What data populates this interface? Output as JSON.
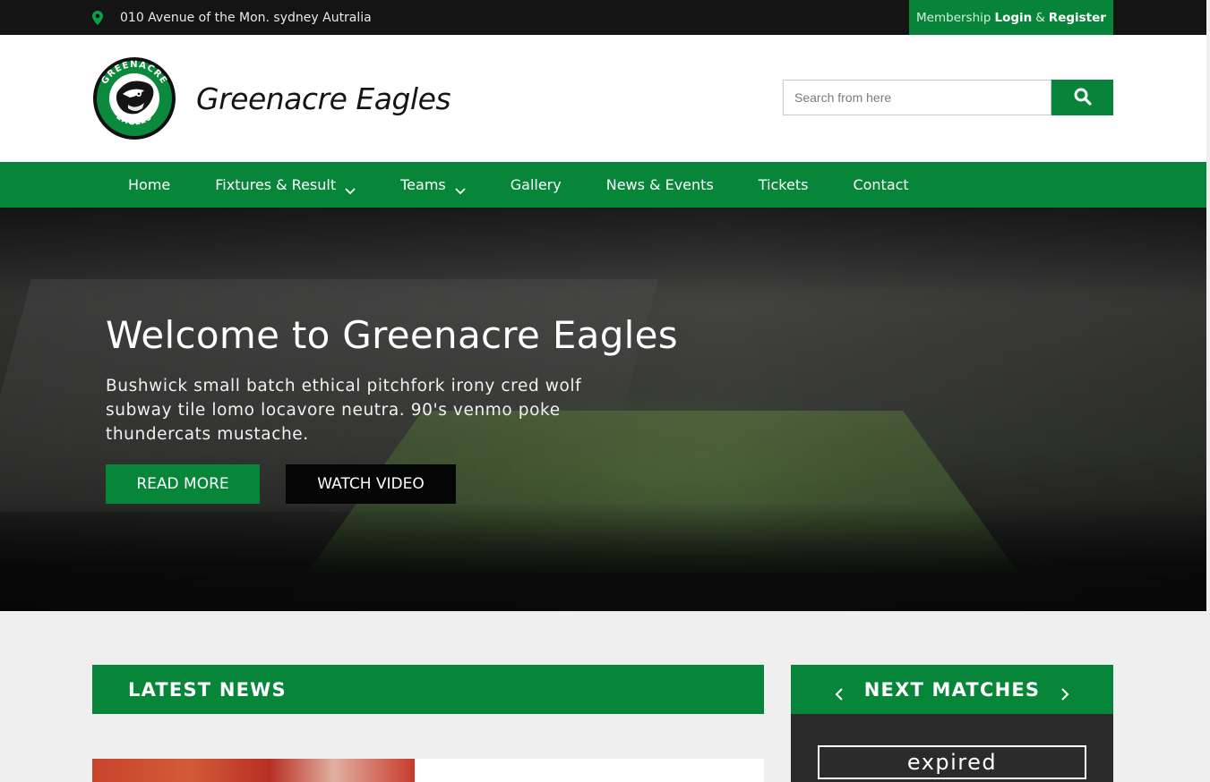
{
  "topbar": {
    "address": "010 Avenue of the Mon. sydney Autralia",
    "membership_label": "Membership",
    "login_label": "Login",
    "amp": "&",
    "register_label": "Register"
  },
  "header": {
    "brand_name": "Greenacre Eagles",
    "logo_text_top": "GREENACRE",
    "logo_text_bottom": "EAGLES",
    "search_placeholder": "Search from here"
  },
  "nav": {
    "items": [
      {
        "label": "Home",
        "has_dropdown": false
      },
      {
        "label": "Fixtures & Result",
        "has_dropdown": true
      },
      {
        "label": "Teams",
        "has_dropdown": true
      },
      {
        "label": "Gallery",
        "has_dropdown": false
      },
      {
        "label": "News & Events",
        "has_dropdown": false
      },
      {
        "label": "Tickets",
        "has_dropdown": false
      },
      {
        "label": "Contact",
        "has_dropdown": false
      }
    ]
  },
  "hero": {
    "title": "Welcome to Greenacre Eagles",
    "description": "Bushwick small batch ethical pitchfork irony cred wolf subway tile lomo locavore neutra. 90's venmo poke thundercats mustache.",
    "read_more_label": "READ MORE",
    "watch_video_label": "WATCH VIDEO"
  },
  "latest_news": {
    "title": "LATEST NEWS"
  },
  "next_matches": {
    "title": "NEXT MATCHES",
    "status": "expired"
  },
  "colors": {
    "brand_green": "#07863a",
    "topbar_bg": "#141414",
    "button_dark": "#050505"
  }
}
